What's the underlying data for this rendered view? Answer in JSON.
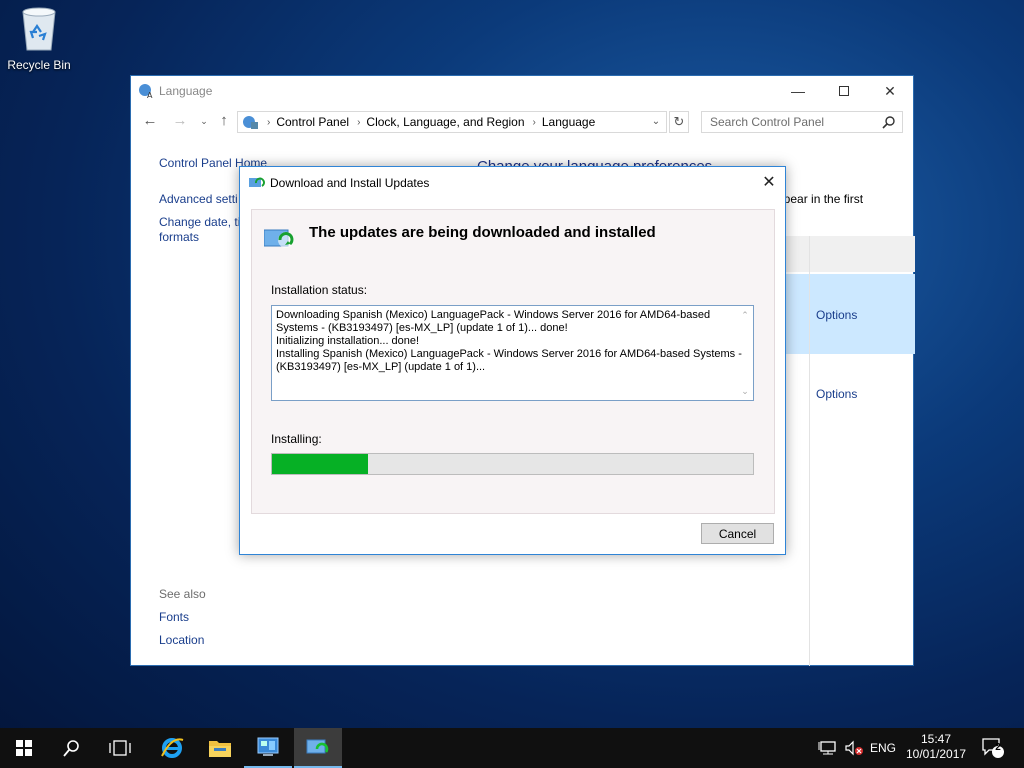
{
  "desktop": {
    "recycle_bin_label": "Recycle Bin"
  },
  "cp_window": {
    "title": "Language",
    "breadcrumb": [
      "Control Panel",
      "Clock, Language, and Region",
      "Language"
    ],
    "search_placeholder": "Search Control Panel",
    "left_links": {
      "home": "Control Panel Home",
      "advanced": "Advanced setti",
      "change_date_1": "Change date, ti",
      "change_date_2": "formats"
    },
    "see_also": {
      "header": "See also",
      "fonts": "Fonts",
      "location": "Location"
    },
    "main": {
      "title": "Change your language preferences",
      "desc_fragment": "ppear in the first",
      "options_1": "Options",
      "options_2": "Options"
    }
  },
  "dialog": {
    "title": "Download and Install Updates",
    "heading": "The updates are being downloaded and installed",
    "status_label": "Installation status:",
    "status_lines": [
      "Downloading Spanish (Mexico) LanguagePack - Windows Server 2016 for AMD64-based",
      "Systems - (KB3193497) [es-MX_LP] (update 1 of 1)... done!",
      "Initializing installation... done!",
      "Installing Spanish (Mexico) LanguagePack - Windows Server 2016 for AMD64-based Systems -",
      "(KB3193497) [es-MX_LP] (update 1 of 1)..."
    ],
    "installing_label": "Installing:",
    "progress_fraction": 0.2,
    "cancel_label": "Cancel"
  },
  "taskbar": {
    "language": "ENG",
    "time": "15:47",
    "date": "10/01/2017",
    "notification_count": "2",
    "accent_color": "#76b9ed"
  },
  "colors": {
    "progress_green": "#06b025",
    "link_blue": "#1a3e8c",
    "selection_blue": "#cce8ff"
  }
}
